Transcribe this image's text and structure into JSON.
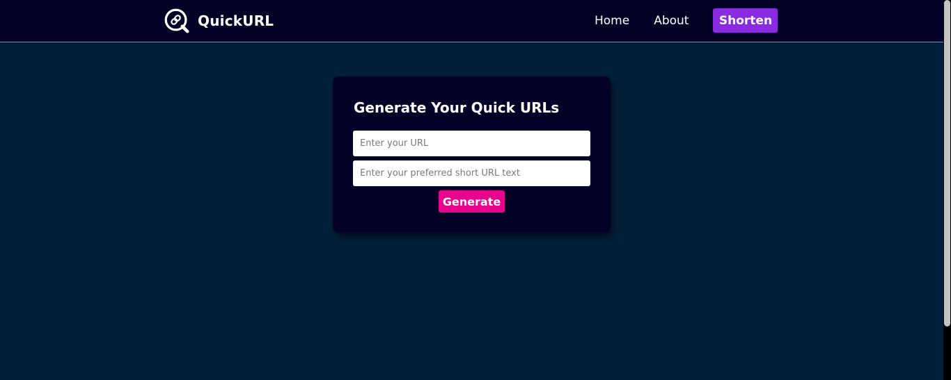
{
  "navbar": {
    "brand": "QuickURL",
    "links": [
      {
        "label": "Home"
      },
      {
        "label": "About"
      }
    ],
    "cta_label": "Shorten"
  },
  "card": {
    "title": "Generate Your Quick URLs",
    "url_input": {
      "value": "",
      "placeholder": "Enter your URL"
    },
    "short_input": {
      "value": "",
      "placeholder": "Enter your preferred short URL text"
    },
    "generate_label": "Generate"
  },
  "colors": {
    "nav_bg": "#030226",
    "page_bg": "#002039",
    "cta_purple": "#8a2be2",
    "generate_pink": "#e8048c"
  },
  "icons": {
    "logo": "link-q-logo-icon"
  }
}
